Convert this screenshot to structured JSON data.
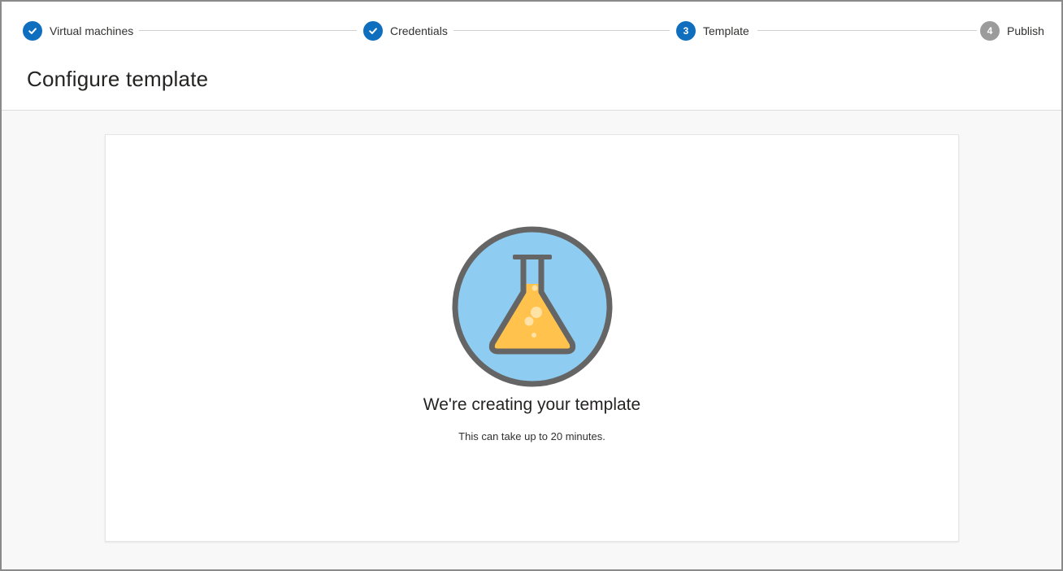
{
  "stepper": {
    "steps": [
      {
        "number": "1",
        "label": "Virtual machines",
        "state": "complete"
      },
      {
        "number": "2",
        "label": "Credentials",
        "state": "complete"
      },
      {
        "number": "3",
        "label": "Template",
        "state": "current"
      },
      {
        "number": "4",
        "label": "Publish",
        "state": "pending"
      }
    ]
  },
  "page": {
    "title": "Configure template"
  },
  "status": {
    "icon": "flask-icon",
    "title": "We're creating your template",
    "subtitle": "This can take up to 20 minutes."
  },
  "colors": {
    "accent": "#106ebe",
    "pending_step": "#9b9b9b",
    "flask_circle_fill": "#8ecdf1",
    "flask_liquid": "#ffc34d",
    "outline": "#656565",
    "content_background": "#f8f8f8"
  }
}
